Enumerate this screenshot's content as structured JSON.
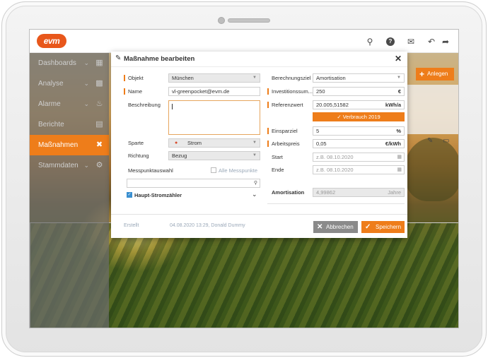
{
  "app": {
    "logo_text": "evm"
  },
  "header": {
    "icons": [
      "search-icon",
      "help-icon",
      "mail-icon",
      "undo-icon",
      "logout-icon"
    ]
  },
  "sidebar": {
    "items": [
      {
        "label": "Dashboards",
        "icon": "grid-icon",
        "chevron": true,
        "active": false
      },
      {
        "label": "Analyse",
        "icon": "bar-chart-icon",
        "chevron": true,
        "active": false
      },
      {
        "label": "Alarme",
        "icon": "bell-icon",
        "chevron": true,
        "active": false
      },
      {
        "label": "Berichte",
        "icon": "report-icon",
        "chevron": false,
        "active": false
      },
      {
        "label": "Maßnahmen",
        "icon": "tools-icon",
        "chevron": false,
        "active": true
      },
      {
        "label": "Stammdaten",
        "icon": "settings-user-icon",
        "chevron": true,
        "active": false
      }
    ]
  },
  "background_actions": {
    "anlegen_label": "Anlegen"
  },
  "modal": {
    "title": "Maßnahme bearbeiten",
    "left": {
      "objekt_label": "Objekt",
      "objekt_value": "München",
      "name_label": "Name",
      "name_value": "vl-greenpocket@evm.de",
      "beschreibung_label": "Beschreibung",
      "beschreibung_value": "",
      "sparte_label": "Sparte",
      "sparte_value": "Strom",
      "richtung_label": "Richtung",
      "richtung_value": "Bezug",
      "messpunkt_label": "Messpunktauswahl",
      "alle_messpunkte_label": "Alle Messpunkte",
      "search_value": "",
      "haupt_label": "Haupt-Stromzähler"
    },
    "right": {
      "berechnungsziel_label": "Berechnungsziel",
      "berechnungsziel_value": "Amortisation",
      "investition_label": "Investitionssum...",
      "investition_value": "250",
      "investition_unit": "€",
      "referenzwert_label": "Referenzwert",
      "referenzwert_value": "20.005,51582",
      "referenzwert_unit": "kWh/a",
      "verbrauch_button": "Verbrauch 2019",
      "einsparziel_label": "Einsparziel",
      "einsparziel_value": "5",
      "einsparziel_unit": "%",
      "arbeitspreis_label": "Arbeitspreis",
      "arbeitspreis_value": "0,05",
      "arbeitspreis_unit": "€/kWh",
      "start_label": "Start",
      "start_placeholder": "z.B. 08.10.2020",
      "ende_label": "Ende",
      "ende_placeholder": "z.B. 08.10.2020",
      "amortisation_label": "Amortisation",
      "amortisation_value": "4,99862",
      "amortisation_unit": "Jahre"
    },
    "footer": {
      "erstellt_label": "Erstellt",
      "erstellt_value": "04.08.2020 13:29, Donald Dummy",
      "abbrechen_label": "Abbrechen",
      "speichern_label": "Speichern"
    }
  },
  "colors": {
    "accent": "#ee7d1a",
    "sidebar_bg": "#6e6e6e",
    "logo": "#e8571b"
  }
}
